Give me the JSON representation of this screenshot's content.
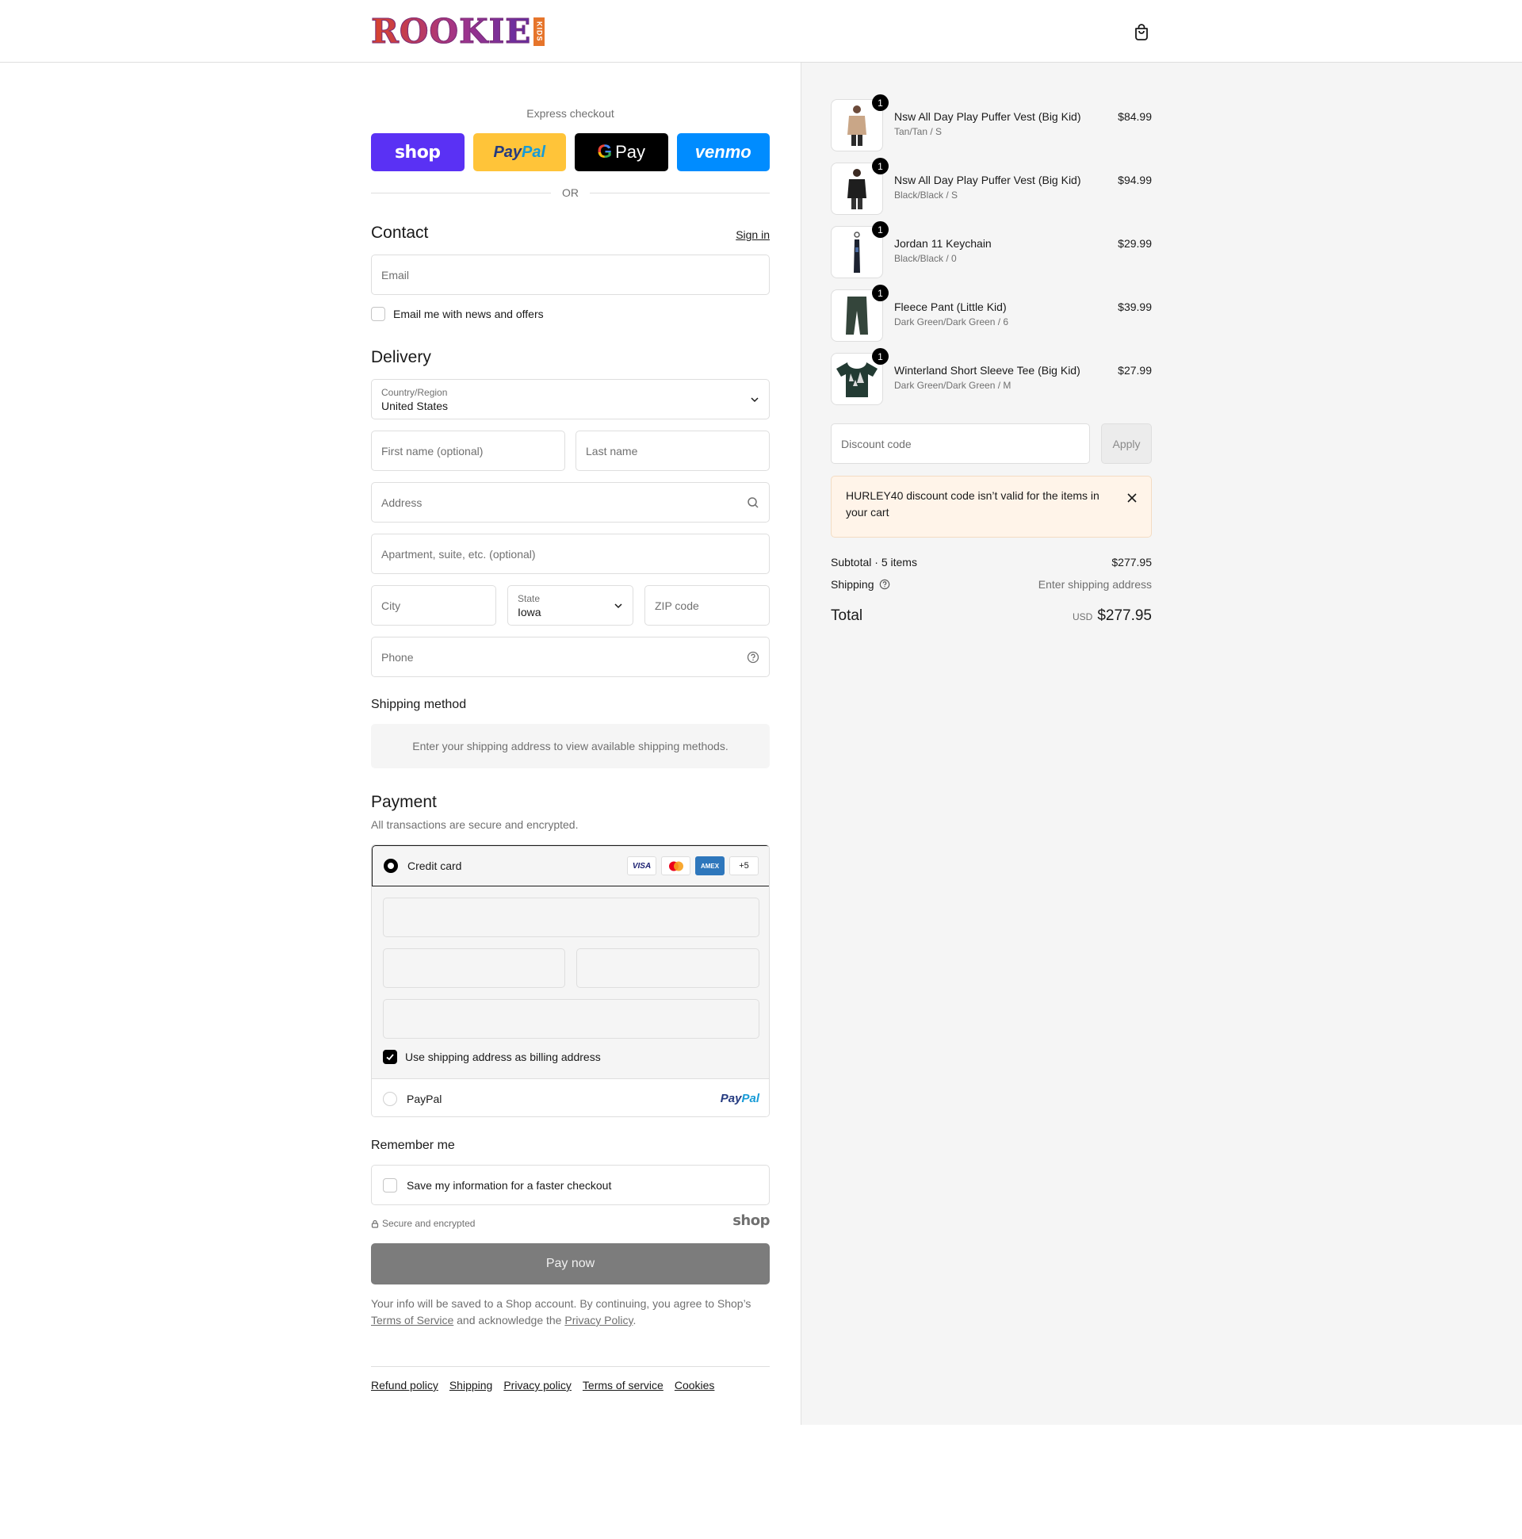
{
  "brand": {
    "name": "ROOKIE",
    "sub": "KIDS"
  },
  "express": {
    "title": "Express checkout",
    "shop": "shop",
    "paypal_a": "Pay",
    "paypal_b": "Pal",
    "gpay_g": "G",
    "gpay": "Pay",
    "venmo": "venmo",
    "or": "OR"
  },
  "contact": {
    "title": "Contact",
    "sign_in": "Sign in",
    "email_placeholder": "Email",
    "news_label": "Email me with news and offers"
  },
  "delivery": {
    "title": "Delivery",
    "country_label": "Country/Region",
    "country_value": "United States",
    "first_name": "First name (optional)",
    "last_name": "Last name",
    "address": "Address",
    "apartment": "Apartment, suite, etc. (optional)",
    "city": "City",
    "state_label": "State",
    "state_value": "Iowa",
    "zip": "ZIP code",
    "phone": "Phone"
  },
  "shipping_method": {
    "title": "Shipping method",
    "message": "Enter your shipping address to view available shipping methods."
  },
  "payment": {
    "title": "Payment",
    "subtitle": "All transactions are secure and encrypted.",
    "credit_card": "Credit card",
    "cards": [
      "VISA",
      "MC",
      "AMEX",
      "+5"
    ],
    "billing_label": "Use shipping address as billing address",
    "paypal_label": "PayPal",
    "paypal_logo_a": "Pay",
    "paypal_logo_b": "Pal"
  },
  "remember": {
    "title": "Remember me",
    "save_label": "Save my information for a faster checkout",
    "secure": "Secure and encrypted",
    "shop": "shop"
  },
  "pay_now": "Pay now",
  "consent": {
    "part1": "Your info will be saved to a Shop account. By continuing, you agree to Shop’s",
    "tos": "Terms of Service",
    "part2": "and acknowledge the",
    "privacy": "Privacy Policy",
    "part3": "."
  },
  "footer_links": [
    "Refund policy",
    "Shipping",
    "Privacy policy",
    "Terms of service",
    "Cookies"
  ],
  "cart": {
    "items": [
      {
        "name": "Nsw All Day Play Puffer Vest (Big Kid)",
        "variant": "Tan/Tan / S",
        "price": "$84.99",
        "qty": "1",
        "color": "#c9a687"
      },
      {
        "name": "Nsw All Day Play Puffer Vest (Big Kid)",
        "variant": "Black/Black / S",
        "price": "$94.99",
        "qty": "1",
        "color": "#1e1e1e"
      },
      {
        "name": "Jordan 11 Keychain",
        "variant": "Black/Black / 0",
        "price": "$29.99",
        "qty": "1",
        "color": "#1c2230"
      },
      {
        "name": "Fleece Pant (Little Kid)",
        "variant": "Dark Green/Dark Green / 6",
        "price": "$39.99",
        "qty": "1",
        "color": "#34453b"
      },
      {
        "name": "Winterland Short Sleeve Tee (Big Kid)",
        "variant": "Dark Green/Dark Green / M",
        "price": "$27.99",
        "qty": "1",
        "color": "#233b33"
      }
    ],
    "discount_placeholder": "Discount code",
    "apply": "Apply",
    "alert": "HURLEY40 discount code isn’t valid for the items in your cart",
    "subtotal_label": "Subtotal · 5 items",
    "subtotal": "$277.95",
    "shipping_label": "Shipping",
    "shipping_value": "Enter shipping address",
    "total_label": "Total",
    "currency": "USD",
    "total": "$277.95"
  }
}
